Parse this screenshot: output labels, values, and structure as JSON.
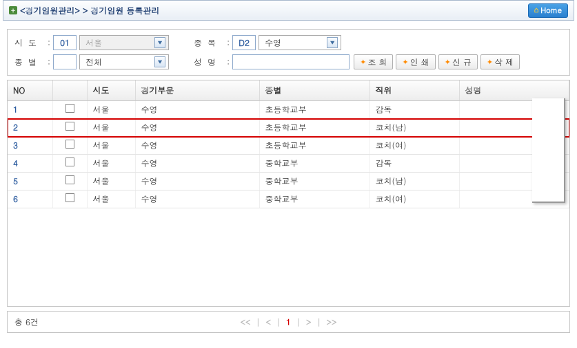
{
  "header": {
    "breadcrumb": "<경기임원관리> > 경기임원 등록관리",
    "home_label": "Home"
  },
  "filters": {
    "sido_label": "시  도",
    "sido_code": "01",
    "sido_combo": "서울",
    "jongmok_label": "종  목",
    "jongmok_code": "D2",
    "jongmok_combo": "수영",
    "jongbyeol_label": "종  별",
    "jongbyeol_combo": "전체",
    "seongmyeong_label": "성  명",
    "seongmyeong_value": ""
  },
  "buttons": {
    "search": "조 회",
    "print": "인 쇄",
    "new": "신 규",
    "delete": "삭 제"
  },
  "columns": {
    "no": "NO",
    "chk": "",
    "sido": "시도",
    "sport": "경기부문",
    "category": "종별",
    "position": "직위",
    "name": "성명"
  },
  "rows": [
    {
      "no": "1",
      "sido": "서울",
      "sport": "수영",
      "category": "초등학교부",
      "position": "감독",
      "name": ""
    },
    {
      "no": "2",
      "sido": "서울",
      "sport": "수영",
      "category": "초등학교부",
      "position": "코치(남)",
      "name": ""
    },
    {
      "no": "3",
      "sido": "서울",
      "sport": "수영",
      "category": "초등학교부",
      "position": "코치(여)",
      "name": ""
    },
    {
      "no": "4",
      "sido": "서울",
      "sport": "수영",
      "category": "중학교부",
      "position": "감독",
      "name": ""
    },
    {
      "no": "5",
      "sido": "서울",
      "sport": "수영",
      "category": "중학교부",
      "position": "코치(남)",
      "name": ""
    },
    {
      "no": "6",
      "sido": "서울",
      "sport": "수영",
      "category": "중학교부",
      "position": "코치(여)",
      "name": ""
    }
  ],
  "highlight_row_index": 1,
  "footer": {
    "total": "총 6건",
    "pager": {
      "first": "<<",
      "prev": "<",
      "current": "1",
      "next": ">",
      "last": ">>"
    }
  }
}
